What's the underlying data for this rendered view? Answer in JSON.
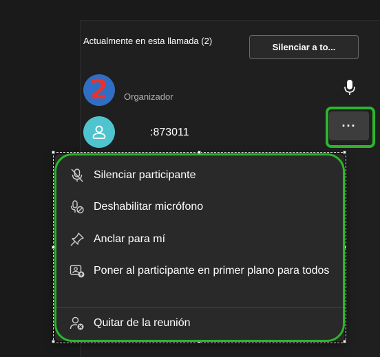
{
  "panel": {
    "header_title": "Actualmente en esta llamada (2)",
    "mute_all_button": "Silenciar a to..."
  },
  "participants": [
    {
      "avatar_text": "2",
      "role": "Organizador",
      "mic": "microphone-icon"
    },
    {
      "name": ":873011",
      "avatar": "person-icon"
    }
  ],
  "more_button_label": "···",
  "context_menu": {
    "items": [
      {
        "label": "Silenciar participante",
        "icon": "mic-off-icon"
      },
      {
        "label": "Deshabilitar micrófono",
        "icon": "mic-disable-icon"
      },
      {
        "label": "Anclar para mí",
        "icon": "pin-icon"
      },
      {
        "label": "Poner al participante en primer plano para todos",
        "icon": "spotlight-icon"
      },
      {
        "label": "Quitar de la reunión",
        "icon": "remove-person-icon"
      }
    ]
  },
  "colors": {
    "highlight": "#2db52d",
    "background": "#1a1a1a",
    "menu_background": "#292929",
    "avatar_user": "#4fc4cf"
  }
}
